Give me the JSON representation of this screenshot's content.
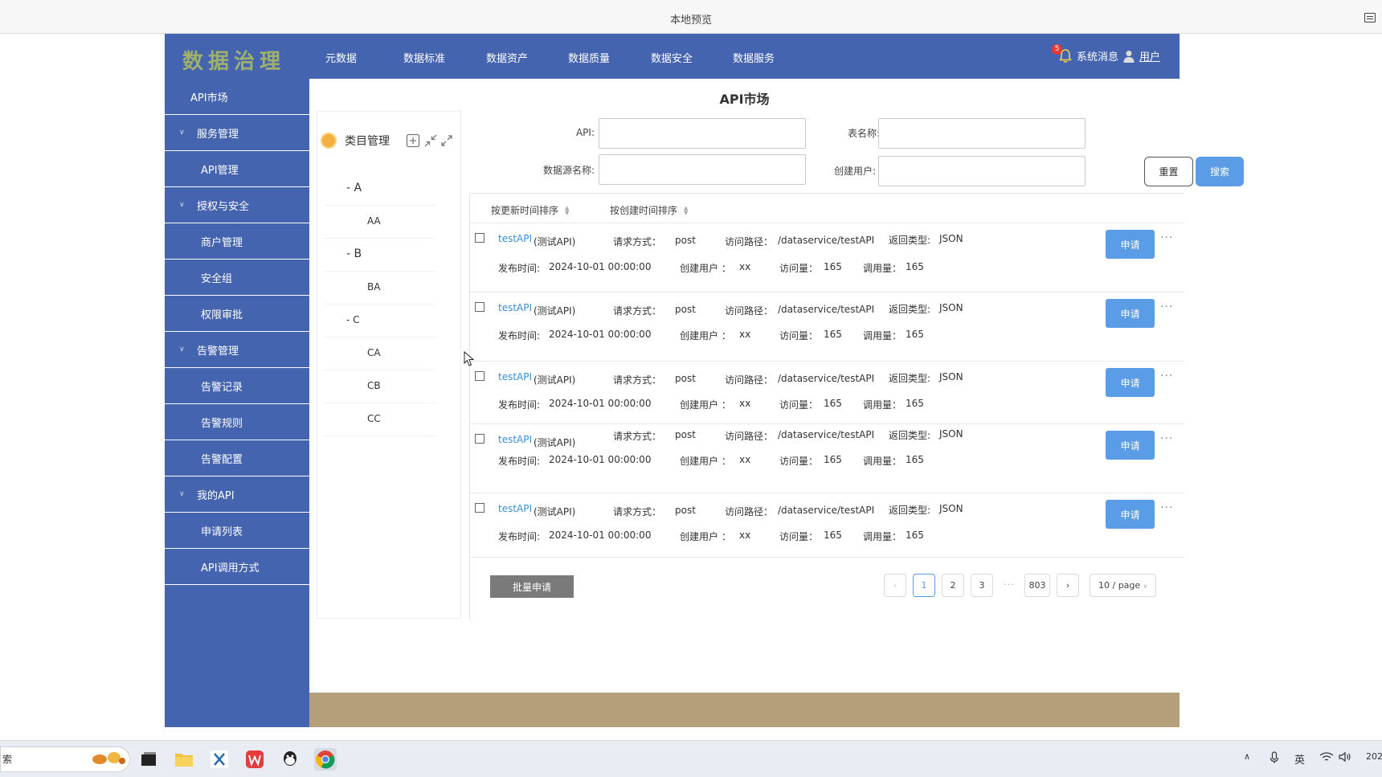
{
  "browser": {
    "title": "本地预览",
    "menu_icon": "menu-icon"
  },
  "app": {
    "logo": "数据治理",
    "nav": [
      "元数据",
      "数据标准",
      "数据资产",
      "数据质量",
      "数据安全",
      "数据服务"
    ],
    "notification_count": "5",
    "messages_label": "系统消息",
    "user_label": "用户"
  },
  "sidebar": {
    "top_item": "API市场",
    "groups": [
      {
        "label": "服务管理",
        "items": [
          "API管理"
        ]
      },
      {
        "label": "授权与安全",
        "items": [
          "商户管理",
          "安全组",
          "权限审批"
        ]
      },
      {
        "label": "告警管理",
        "items": [
          "告警记录",
          "告警规则",
          "告警配置"
        ]
      },
      {
        "label": "我的API",
        "items": [
          "申请列表",
          "API调用方式"
        ]
      }
    ]
  },
  "page": {
    "title": "API市场"
  },
  "category_panel": {
    "title": "类目管理",
    "tree": [
      {
        "label": "- A",
        "level": 0
      },
      {
        "label": "AA",
        "level": 1
      },
      {
        "label": "- B",
        "level": 0
      },
      {
        "label": "BA",
        "level": 1
      },
      {
        "label": "- C",
        "level": 0
      },
      {
        "label": "CA",
        "level": 1
      },
      {
        "label": "CB",
        "level": 1
      },
      {
        "label": "CC",
        "level": 1
      }
    ]
  },
  "filters": {
    "api_label": "API:",
    "table_label": "表名称:",
    "datasource_label": "数据源名称:",
    "creator_label": "创建用户:",
    "api_value": "",
    "table_value": "",
    "datasource_value": "",
    "creator_value": "",
    "reset_label": "重置",
    "search_label": "搜索"
  },
  "sort": {
    "by_update": "按更新时间排序",
    "by_create": "按创建时间排序"
  },
  "api_rows": [
    {
      "name": "testAPI",
      "cn": "(测试API)",
      "method_label": "请求方式：",
      "method": "post",
      "path_label": "访问路径：",
      "path": "/dataservice/testAPI",
      "return_label": "返回类型:",
      "return_type": "JSON",
      "publish_label": "发布时间:",
      "publish_time": "2024-10-01 00:00:00",
      "creator_label": "创建用户 ：",
      "creator": "xx",
      "visits_label": "访问量：",
      "visits": "165",
      "calls_label": "调用量：",
      "calls": "165",
      "apply_label": "申请",
      "more": "···"
    },
    {
      "name": "testAPI",
      "cn": "(测试API)",
      "method_label": "请求方式：",
      "method": "post",
      "path_label": "访问路径：",
      "path": "/dataservice/testAPI",
      "return_label": "返回类型:",
      "return_type": "JSON",
      "publish_label": "发布时间:",
      "publish_time": "2024-10-01 00:00:00",
      "creator_label": "创建用户 ：",
      "creator": "xx",
      "visits_label": "访问量：",
      "visits": "165",
      "calls_label": "调用量：",
      "calls": "165",
      "apply_label": "申请",
      "more": "···"
    },
    {
      "name": "testAPI",
      "cn": "(测试API)",
      "method_label": "请求方式：",
      "method": "post",
      "path_label": "访问路径：",
      "path": "/dataservice/testAPI",
      "return_label": "返回类型:",
      "return_type": "JSON",
      "publish_label": "发布时间:",
      "publish_time": "2024-10-01 00:00:00",
      "creator_label": "创建用户 ：",
      "creator": "xx",
      "visits_label": "访问量：",
      "visits": "165",
      "calls_label": "调用量：",
      "calls": "165",
      "apply_label": "申请",
      "more": "···"
    },
    {
      "name": "testAPI",
      "cn": "(测试API)",
      "method_label": "请求方式：",
      "method": "post",
      "path_label": "访问路径：",
      "path": "/dataservice/testAPI",
      "return_label": "返回类型:",
      "return_type": "JSON",
      "publish_label": "发布时间:",
      "publish_time": "2024-10-01 00:00:00",
      "creator_label": "创建用户 ：",
      "creator": "xx",
      "visits_label": "访问量：",
      "visits": "165",
      "calls_label": "调用量：",
      "calls": "165",
      "apply_label": "申请",
      "more": "···"
    },
    {
      "name": "testAPI",
      "cn": "(测试API)",
      "method_label": "请求方式：",
      "method": "post",
      "path_label": "访问路径：",
      "path": "/dataservice/testAPI",
      "return_label": "返回类型:",
      "return_type": "JSON",
      "publish_label": "发布时间:",
      "publish_time": "2024-10-01 00:00:00",
      "creator_label": "创建用户 ：",
      "creator": "xx",
      "visits_label": "访问量：",
      "visits": "165",
      "calls_label": "调用量：",
      "calls": "165",
      "apply_label": "申请",
      "more": "···"
    }
  ],
  "batch_label": "批量申请",
  "pagination": {
    "prev": "‹",
    "pages": [
      "1",
      "2",
      "3"
    ],
    "ellipsis": "···",
    "last": "803",
    "next": "›",
    "current": "1",
    "page_size": "10 / page"
  },
  "taskbar": {
    "search_text": "索",
    "tray": {
      "ime": "英",
      "clock_fragment": "202"
    }
  },
  "colors": {
    "primary_nav": "#4564b0",
    "accent_button": "#5b9ce6",
    "logo_text": "#9fb06b",
    "footer_band": "#b59f7a",
    "link": "#3a8fd6"
  }
}
